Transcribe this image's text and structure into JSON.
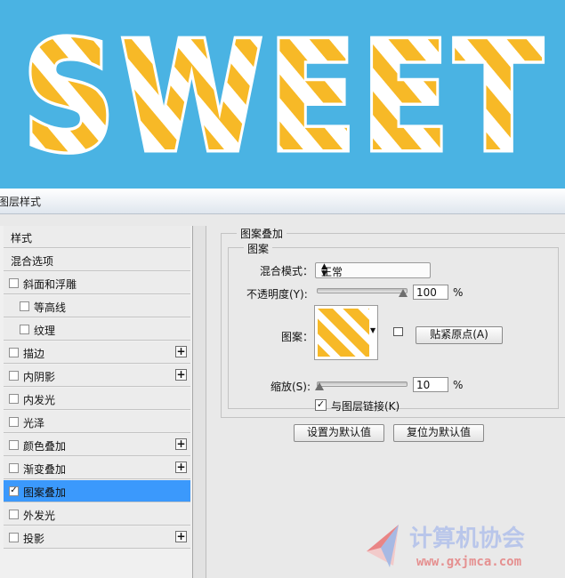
{
  "banner": {
    "text": "SWEET"
  },
  "dialog": {
    "title": "图层样式"
  },
  "styles_list": [
    {
      "label": "样式",
      "checkbox": false,
      "plus": false,
      "indent": false,
      "checked": false
    },
    {
      "label": "混合选项",
      "checkbox": false,
      "plus": false,
      "indent": false,
      "checked": false
    },
    {
      "label": "斜面和浮雕",
      "checkbox": true,
      "plus": false,
      "indent": false,
      "checked": false
    },
    {
      "label": "等高线",
      "checkbox": true,
      "plus": false,
      "indent": true,
      "checked": false
    },
    {
      "label": "纹理",
      "checkbox": true,
      "plus": false,
      "indent": true,
      "checked": false
    },
    {
      "label": "描边",
      "checkbox": true,
      "plus": true,
      "indent": false,
      "checked": false
    },
    {
      "label": "内阴影",
      "checkbox": true,
      "plus": true,
      "indent": false,
      "checked": false
    },
    {
      "label": "内发光",
      "checkbox": true,
      "plus": false,
      "indent": false,
      "checked": false
    },
    {
      "label": "光泽",
      "checkbox": true,
      "plus": false,
      "indent": false,
      "checked": false
    },
    {
      "label": "颜色叠加",
      "checkbox": true,
      "plus": true,
      "indent": false,
      "checked": false
    },
    {
      "label": "渐变叠加",
      "checkbox": true,
      "plus": true,
      "indent": false,
      "checked": false
    },
    {
      "label": "图案叠加",
      "checkbox": true,
      "plus": false,
      "indent": false,
      "checked": true,
      "active": true
    },
    {
      "label": "外发光",
      "checkbox": true,
      "plus": false,
      "indent": false,
      "checked": false
    },
    {
      "label": "投影",
      "checkbox": true,
      "plus": true,
      "indent": false,
      "checked": false
    }
  ],
  "panel": {
    "group_title": "图案叠加",
    "subgroup_title": "图案",
    "blend_mode_label": "混合模式：",
    "blend_mode_value": "正常",
    "opacity_label": "不透明度(Y):",
    "opacity_value": "100",
    "opacity_unit": "%",
    "pattern_label": "图案：",
    "snap_origin_button": "贴紧原点(A)",
    "scale_label": "缩放(S):",
    "scale_value": "10",
    "scale_unit": "%",
    "link_layer_label": "与图层链接(K)",
    "link_layer_checked": true,
    "set_default_button": "设置为默认值",
    "reset_default_button": "复位为默认值"
  },
  "watermark": {
    "title": "计算机协会",
    "url": "www.gxjmca.com"
  },
  "colors": {
    "banner_bg": "#4ab3e3",
    "stripe_yellow": "#f7b927",
    "highlight": "#3b99fc"
  }
}
